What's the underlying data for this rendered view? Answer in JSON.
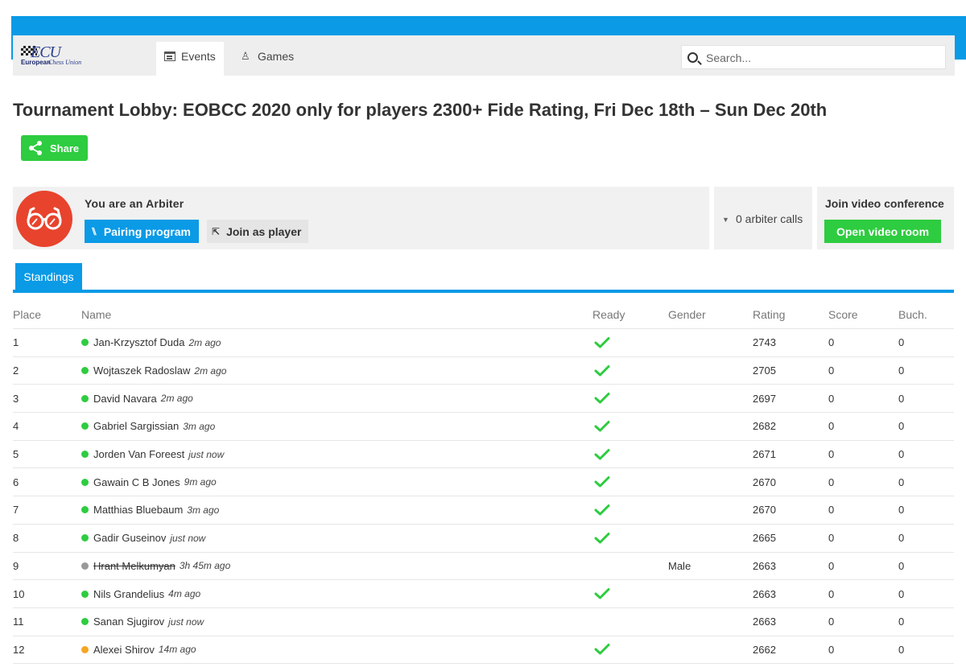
{
  "header": {
    "logo": {
      "mark": "ECU",
      "line1": "European",
      "line2": "Chess Union"
    },
    "nav": [
      {
        "label": "Events",
        "icon": "calendar-icon",
        "active": true
      },
      {
        "label": "Games",
        "icon": "chess-pawn-icon",
        "active": false
      }
    ],
    "search": {
      "placeholder": "Search..."
    }
  },
  "page": {
    "title": "Tournament Lobby: EOBCC 2020 only for players 2300+ Fide Rating, Fri Dec 18th – Sun Dec 20th",
    "share_label": "Share"
  },
  "arbiter": {
    "role_text": "You are an Arbiter",
    "pairing_label": "Pairing program",
    "join_label": "Join as player",
    "calls_text": "0 arbiter calls",
    "video_label": "Join video conference",
    "video_button": "Open video room"
  },
  "tabs": {
    "standings": "Standings"
  },
  "standings": {
    "columns": [
      "Place",
      "Name",
      "Ready",
      "Gender",
      "Rating",
      "Score",
      "Buch."
    ],
    "rows": [
      {
        "place": "1",
        "name": "Jan-Krzysztof Duda",
        "ago": "2m ago",
        "status": "online",
        "ready": true,
        "gender": "",
        "rating": "2743",
        "score": "0",
        "buch": "0"
      },
      {
        "place": "2",
        "name": "Wojtaszek Radoslaw",
        "ago": "2m ago",
        "status": "online",
        "ready": true,
        "gender": "",
        "rating": "2705",
        "score": "0",
        "buch": "0"
      },
      {
        "place": "3",
        "name": "David Navara",
        "ago": "2m ago",
        "status": "online",
        "ready": true,
        "gender": "",
        "rating": "2697",
        "score": "0",
        "buch": "0"
      },
      {
        "place": "4",
        "name": "Gabriel Sargissian",
        "ago": "3m ago",
        "status": "online",
        "ready": true,
        "gender": "",
        "rating": "2682",
        "score": "0",
        "buch": "0"
      },
      {
        "place": "5",
        "name": "Jorden Van Foreest",
        "ago": "just now",
        "status": "online",
        "ready": true,
        "gender": "",
        "rating": "2671",
        "score": "0",
        "buch": "0"
      },
      {
        "place": "6",
        "name": "Gawain C B Jones",
        "ago": "9m ago",
        "status": "online",
        "ready": true,
        "gender": "",
        "rating": "2670",
        "score": "0",
        "buch": "0"
      },
      {
        "place": "7",
        "name": "Matthias Bluebaum",
        "ago": "3m ago",
        "status": "online",
        "ready": true,
        "gender": "",
        "rating": "2670",
        "score": "0",
        "buch": "0"
      },
      {
        "place": "8",
        "name": "Gadir Guseinov",
        "ago": "just now",
        "status": "online",
        "ready": true,
        "gender": "",
        "rating": "2665",
        "score": "0",
        "buch": "0"
      },
      {
        "place": "9",
        "name": "Hrant Melkumyan",
        "ago": "3h 45m ago",
        "status": "offline",
        "ready": false,
        "gender": "Male",
        "rating": "2663",
        "score": "0",
        "buch": "0",
        "struck": true
      },
      {
        "place": "10",
        "name": "Nils Grandelius",
        "ago": "4m ago",
        "status": "online",
        "ready": true,
        "gender": "",
        "rating": "2663",
        "score": "0",
        "buch": "0"
      },
      {
        "place": "11",
        "name": "Sanan Sjugirov",
        "ago": "just now",
        "status": "online",
        "ready": false,
        "gender": "",
        "rating": "2663",
        "score": "0",
        "buch": "0"
      },
      {
        "place": "12",
        "name": "Alexei Shirov",
        "ago": "14m ago",
        "status": "away",
        "ready": true,
        "gender": "",
        "rating": "2662",
        "score": "0",
        "buch": "0"
      }
    ]
  },
  "colors": {
    "accent": "#0a9ae6",
    "success": "#2ecc40",
    "arbiter_avatar": "#e8432d",
    "status_online": "#2ecc40",
    "status_offline": "#999999",
    "status_away": "#f5a623"
  }
}
